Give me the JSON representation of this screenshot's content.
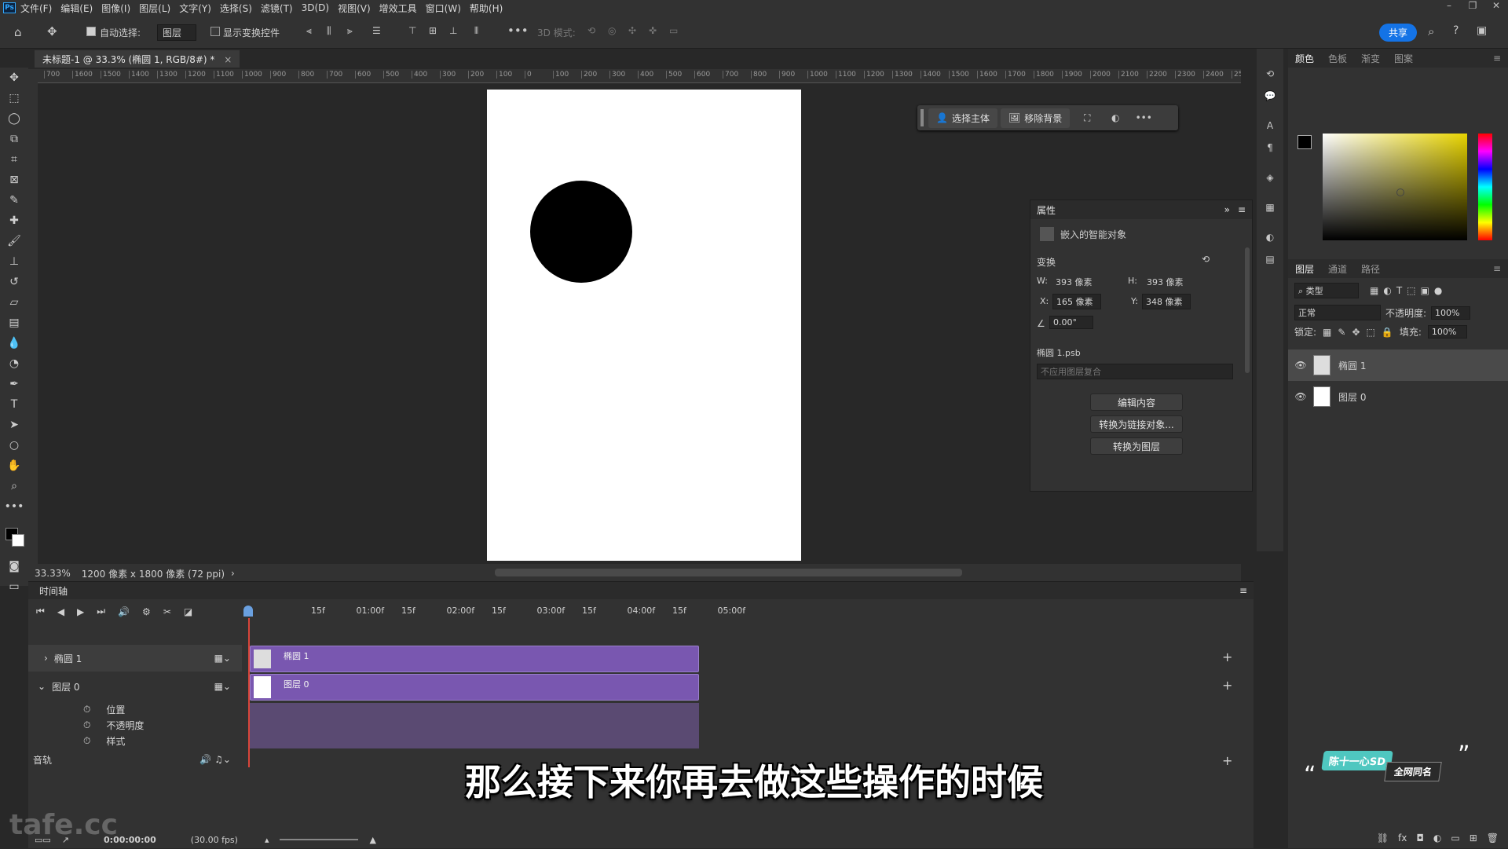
{
  "menu": {
    "logo": "Ps",
    "items": [
      "文件(F)",
      "编辑(E)",
      "图像(I)",
      "图层(L)",
      "文字(Y)",
      "选择(S)",
      "滤镜(T)",
      "3D(D)",
      "视图(V)",
      "增效工具",
      "窗口(W)",
      "帮助(H)"
    ]
  },
  "options": {
    "auto_select_label": "自动选择:",
    "auto_select_value": "图层",
    "show_transform_label": "显示变换控件",
    "mode_3d_label": "3D 模式:",
    "share_label": "共享"
  },
  "document": {
    "tab_title": "未标题-1 @ 33.3% (椭圆 1, RGB/8#) *",
    "ruler_ticks": [
      "700",
      "1600",
      "1500",
      "1400",
      "1300",
      "1200",
      "1100",
      "1000",
      "900",
      "800",
      "700",
      "600",
      "500",
      "400",
      "300",
      "200",
      "100",
      "0",
      "100",
      "200",
      "300",
      "400",
      "500",
      "600",
      "700",
      "800",
      "900",
      "1000",
      "1100",
      "1200",
      "1300",
      "1400",
      "1500",
      "1600",
      "1700",
      "1800",
      "1900",
      "2000",
      "2100",
      "2200",
      "2300",
      "2400",
      "2500"
    ],
    "zoom": "33.33%",
    "doc_info": "1200 像素 x 1800 像素 (72 ppi)"
  },
  "context_bar": {
    "select_subject": "选择主体",
    "remove_bg": "移除背景"
  },
  "properties": {
    "title": "属性",
    "object_type": "嵌入的智能对象",
    "transform_label": "变换",
    "w_label": "W:",
    "w_value": "393 像素",
    "h_label": "H:",
    "h_value": "393 像素",
    "x_label": "X:",
    "x_value": "165 像素",
    "y_label": "Y:",
    "y_value": "348 像素",
    "angle_value": "0.00°",
    "file_name": "椭圆 1.psb",
    "comp_placeholder": "不应用图层复合",
    "btn_edit": "编辑内容",
    "btn_convert_linked": "转换为链接对象...",
    "btn_convert_layer": "转换为图层"
  },
  "color_panel": {
    "tabs": [
      "颜色",
      "色板",
      "渐变",
      "图案"
    ],
    "fg_color": "#000000",
    "bg_color": "#ffffff",
    "hue_color": "#e8d400"
  },
  "layers_panel": {
    "tabs": [
      "图层",
      "通道",
      "路径"
    ],
    "filter_label": "类型",
    "blend_mode": "正常",
    "opacity_label": "不透明度:",
    "opacity_value": "100%",
    "lock_label": "锁定:",
    "fill_label": "填充:",
    "fill_value": "100%",
    "layers": [
      {
        "name": "椭圆 1",
        "selected": true
      },
      {
        "name": "图层 0",
        "selected": false
      }
    ]
  },
  "timeline": {
    "title": "时间轴",
    "ticks": [
      "15f",
      "01:00f",
      "15f",
      "02:00f",
      "15f",
      "03:00f",
      "15f",
      "04:00f",
      "15f",
      "05:00f"
    ],
    "tracks": [
      {
        "name": "椭圆 1"
      },
      {
        "name": "图层 0"
      }
    ],
    "props": [
      "位置",
      "不透明度",
      "样式"
    ],
    "audio_label": "音轨",
    "timecode": "0:00:00:00",
    "fps": "(30.00 fps)"
  },
  "subtitle": "那么接下来你再去做这些操作的时候",
  "watermark": "tafe.cc",
  "badge": {
    "line1": "陈十一心SD",
    "line2": "全网同名"
  }
}
